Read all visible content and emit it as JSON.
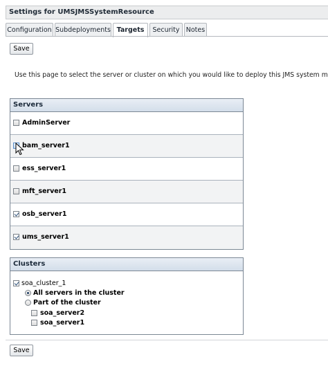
{
  "window": {
    "title": "Settings for UMSJMSSystemResource"
  },
  "tabs": [
    {
      "label": "Configuration",
      "active": false
    },
    {
      "label": "Subdeployments",
      "active": false
    },
    {
      "label": "Targets",
      "active": true
    },
    {
      "label": "Security",
      "active": false
    },
    {
      "label": "Notes",
      "active": false
    }
  ],
  "toolbar": {
    "save_label": "Save"
  },
  "instructions": "Use this page to select the server or cluster on which you would like to deploy this JMS system module. You can",
  "servers": {
    "header": "Servers",
    "items": [
      {
        "label": "AdminServer",
        "checked": false
      },
      {
        "label": "bam_server1",
        "checked": false
      },
      {
        "label": "ess_server1",
        "checked": false
      },
      {
        "label": "mft_server1",
        "checked": false
      },
      {
        "label": "osb_server1",
        "checked": true
      },
      {
        "label": "ums_server1",
        "checked": true
      }
    ]
  },
  "clusters": {
    "header": "Clusters",
    "cluster_name": "soa_cluster_1",
    "cluster_checked": true,
    "option_all": "All servers in the cluster",
    "option_part": "Part of the cluster",
    "selected_option": "All servers in the cluster",
    "members": [
      {
        "label": "soa_server2",
        "checked": false
      },
      {
        "label": "soa_server1",
        "checked": false
      }
    ]
  },
  "footer": {
    "save_label": "Save"
  }
}
